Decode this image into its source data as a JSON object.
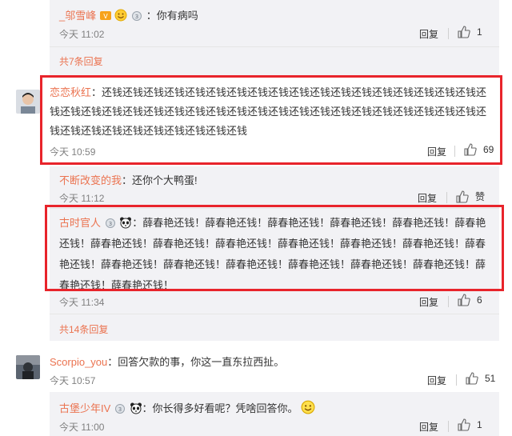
{
  "thread1": {
    "reply1": {
      "name": "_邬雪峰",
      "text": "：你有病吗",
      "time": "今天 11:02",
      "reply": "回复",
      "likes": "1"
    },
    "more": "共7条回复"
  },
  "comment1": {
    "name": "恋恋秋红",
    "text": "：还钱还钱还钱还钱还钱还钱还钱还钱还钱还钱还钱还钱还钱还钱还钱还钱还钱还钱还钱还钱还钱还钱还钱还钱还钱还钱还钱还钱还钱还钱还钱还钱还钱还钱还钱还钱还钱还钱还钱还钱还钱还钱还钱还钱还钱还钱还钱还钱还钱",
    "time": "今天 10:59",
    "reply": "回复",
    "likes": "69"
  },
  "thread2": {
    "reply1": {
      "name": "不断改变的我",
      "text": "：还你个大鸭蛋!",
      "time": "今天 11:12",
      "reply": "回复",
      "likes": "赞"
    },
    "reply2": {
      "name": "古时官人",
      "text": "：薛春艳还钱！薛春艳还钱！薛春艳还钱！薛春艳还钱！薛春艳还钱！薛春艳还钱！薛春艳还钱！薛春艳还钱！薛春艳还钱！薛春艳还钱！薛春艳还钱！薛春艳还钱！薛春艳还钱！薛春艳还钱！薛春艳还钱！薛春艳还钱！薛春艳还钱！薛春艳还钱！薛春艳还钱！薛春艳还钱！薛春艳还钱！",
      "time": "今天 11:34",
      "reply": "回复",
      "likes": "6"
    },
    "more": "共14条回复"
  },
  "comment2": {
    "name": "Scorpio_you",
    "text": "：回答欠款的事，你这一直东拉西扯。",
    "time": "今天 10:57",
    "reply": "回复",
    "likes": "51"
  },
  "thread3": {
    "reply1": {
      "name": "古堡少年IV",
      "text": "：你长得多好看呢？凭啥回答你。",
      "time": "今天 11:00",
      "reply": "回复",
      "likes": "1"
    }
  },
  "colors": {
    "name": "#eb7350",
    "highlight": "#e8242b",
    "reply_bg": "#f2f2f5"
  },
  "icons": [
    "vip-badge-icon",
    "smile-emoji-icon",
    "medal-icon",
    "panda-icon",
    "thumb-up-icon",
    "avatar"
  ]
}
